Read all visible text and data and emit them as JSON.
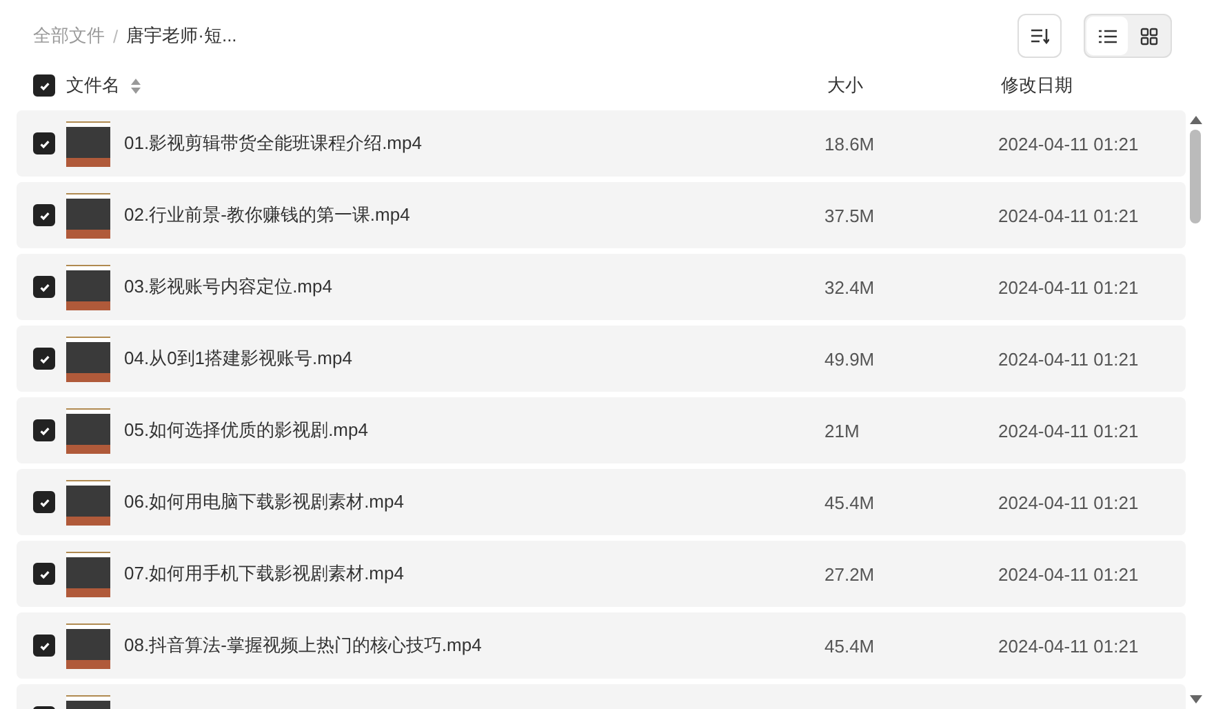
{
  "breadcrumb_separator": "/",
  "breadcrumb": [
    {
      "label": "全部文件",
      "current": false
    },
    {
      "label": "唐宇老师·短...",
      "current": true
    }
  ],
  "toolbar": {
    "view_modes": [
      {
        "kind": "list",
        "selected": true
      },
      {
        "kind": "grid",
        "selected": false
      }
    ]
  },
  "table": {
    "select_all": {
      "checked": true
    },
    "columns": [
      "文件名",
      "大小",
      "修改日期"
    ],
    "rows": [
      {
        "name": "01.影视剪辑带货全能班课程介绍.mp4",
        "size": "18.6M",
        "modified": "2024-04-11 01:21",
        "checked": true
      },
      {
        "name": "02.行业前景-教你赚钱的第一课.mp4",
        "size": "37.5M",
        "modified": "2024-04-11 01:21",
        "checked": true
      },
      {
        "name": "03.影视账号内容定位.mp4",
        "size": "32.4M",
        "modified": "2024-04-11 01:21",
        "checked": true
      },
      {
        "name": "04.从0到1搭建影视账号.mp4",
        "size": "49.9M",
        "modified": "2024-04-11 01:21",
        "checked": true
      },
      {
        "name": "05.如何选择优质的影视剧.mp4",
        "size": "21M",
        "modified": "2024-04-11 01:21",
        "checked": true
      },
      {
        "name": "06.如何用电脑下载影视剧素材.mp4",
        "size": "45.4M",
        "modified": "2024-04-11 01:21",
        "checked": true
      },
      {
        "name": "07.如何用手机下载影视剧素材.mp4",
        "size": "27.2M",
        "modified": "2024-04-11 01:21",
        "checked": true
      },
      {
        "name": "08.抖音算法-掌握视频上热门的核心技巧.mp4",
        "size": "45.4M",
        "modified": "2024-04-11 01:21",
        "checked": true
      },
      {
        "checked": true
      }
    ]
  }
}
